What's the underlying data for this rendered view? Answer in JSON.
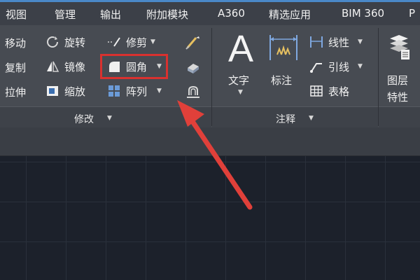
{
  "menu_tabs": [
    "视图",
    "管理",
    "输出",
    "附加模块",
    "A360",
    "精选应用",
    "BIM 360",
    "P"
  ],
  "modify_panel": {
    "title": "修改",
    "tools": {
      "move": "移动",
      "rotate": "旋转",
      "trim": "修剪",
      "copy": "复制",
      "mirror": "镜像",
      "fillet": "圆角",
      "stretch": "拉伸",
      "scale": "缩放",
      "array": "阵列"
    }
  },
  "annotation_panel": {
    "title": "注释",
    "tools": {
      "text": "文字",
      "dimension": "标注",
      "linear": "线性",
      "leader": "引线",
      "table": "表格",
      "text_big_glyph": "A"
    }
  },
  "layers_panel": {
    "label_line1": "图层",
    "label_line2": "特性"
  },
  "colors": {
    "highlight": "#d9312f",
    "arrow": "#e0403a",
    "tab_accent": "#4a88c8"
  },
  "icons": [
    "rotate-icon",
    "trim-icon",
    "mirror-icon",
    "fillet-icon",
    "scale-icon",
    "array-icon",
    "text-icon",
    "dimension-icon",
    "linear-icon",
    "leader-icon",
    "table-icon",
    "layer-properties-icon"
  ]
}
